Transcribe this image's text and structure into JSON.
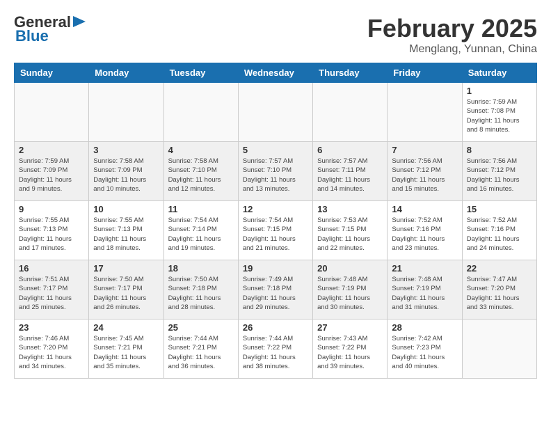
{
  "header": {
    "logo_general": "General",
    "logo_blue": "Blue",
    "month": "February 2025",
    "location": "Menglang, Yunnan, China"
  },
  "days_of_week": [
    "Sunday",
    "Monday",
    "Tuesday",
    "Wednesday",
    "Thursday",
    "Friday",
    "Saturday"
  ],
  "weeks": [
    [
      {
        "day": "",
        "info": ""
      },
      {
        "day": "",
        "info": ""
      },
      {
        "day": "",
        "info": ""
      },
      {
        "day": "",
        "info": ""
      },
      {
        "day": "",
        "info": ""
      },
      {
        "day": "",
        "info": ""
      },
      {
        "day": "1",
        "info": "Sunrise: 7:59 AM\nSunset: 7:08 PM\nDaylight: 11 hours and 8 minutes."
      }
    ],
    [
      {
        "day": "2",
        "info": "Sunrise: 7:59 AM\nSunset: 7:09 PM\nDaylight: 11 hours and 9 minutes."
      },
      {
        "day": "3",
        "info": "Sunrise: 7:58 AM\nSunset: 7:09 PM\nDaylight: 11 hours and 10 minutes."
      },
      {
        "day": "4",
        "info": "Sunrise: 7:58 AM\nSunset: 7:10 PM\nDaylight: 11 hours and 12 minutes."
      },
      {
        "day": "5",
        "info": "Sunrise: 7:57 AM\nSunset: 7:10 PM\nDaylight: 11 hours and 13 minutes."
      },
      {
        "day": "6",
        "info": "Sunrise: 7:57 AM\nSunset: 7:11 PM\nDaylight: 11 hours and 14 minutes."
      },
      {
        "day": "7",
        "info": "Sunrise: 7:56 AM\nSunset: 7:12 PM\nDaylight: 11 hours and 15 minutes."
      },
      {
        "day": "8",
        "info": "Sunrise: 7:56 AM\nSunset: 7:12 PM\nDaylight: 11 hours and 16 minutes."
      }
    ],
    [
      {
        "day": "9",
        "info": "Sunrise: 7:55 AM\nSunset: 7:13 PM\nDaylight: 11 hours and 17 minutes."
      },
      {
        "day": "10",
        "info": "Sunrise: 7:55 AM\nSunset: 7:13 PM\nDaylight: 11 hours and 18 minutes."
      },
      {
        "day": "11",
        "info": "Sunrise: 7:54 AM\nSunset: 7:14 PM\nDaylight: 11 hours and 19 minutes."
      },
      {
        "day": "12",
        "info": "Sunrise: 7:54 AM\nSunset: 7:15 PM\nDaylight: 11 hours and 21 minutes."
      },
      {
        "day": "13",
        "info": "Sunrise: 7:53 AM\nSunset: 7:15 PM\nDaylight: 11 hours and 22 minutes."
      },
      {
        "day": "14",
        "info": "Sunrise: 7:52 AM\nSunset: 7:16 PM\nDaylight: 11 hours and 23 minutes."
      },
      {
        "day": "15",
        "info": "Sunrise: 7:52 AM\nSunset: 7:16 PM\nDaylight: 11 hours and 24 minutes."
      }
    ],
    [
      {
        "day": "16",
        "info": "Sunrise: 7:51 AM\nSunset: 7:17 PM\nDaylight: 11 hours and 25 minutes."
      },
      {
        "day": "17",
        "info": "Sunrise: 7:50 AM\nSunset: 7:17 PM\nDaylight: 11 hours and 26 minutes."
      },
      {
        "day": "18",
        "info": "Sunrise: 7:50 AM\nSunset: 7:18 PM\nDaylight: 11 hours and 28 minutes."
      },
      {
        "day": "19",
        "info": "Sunrise: 7:49 AM\nSunset: 7:18 PM\nDaylight: 11 hours and 29 minutes."
      },
      {
        "day": "20",
        "info": "Sunrise: 7:48 AM\nSunset: 7:19 PM\nDaylight: 11 hours and 30 minutes."
      },
      {
        "day": "21",
        "info": "Sunrise: 7:48 AM\nSunset: 7:19 PM\nDaylight: 11 hours and 31 minutes."
      },
      {
        "day": "22",
        "info": "Sunrise: 7:47 AM\nSunset: 7:20 PM\nDaylight: 11 hours and 33 minutes."
      }
    ],
    [
      {
        "day": "23",
        "info": "Sunrise: 7:46 AM\nSunset: 7:20 PM\nDaylight: 11 hours and 34 minutes."
      },
      {
        "day": "24",
        "info": "Sunrise: 7:45 AM\nSunset: 7:21 PM\nDaylight: 11 hours and 35 minutes."
      },
      {
        "day": "25",
        "info": "Sunrise: 7:44 AM\nSunset: 7:21 PM\nDaylight: 11 hours and 36 minutes."
      },
      {
        "day": "26",
        "info": "Sunrise: 7:44 AM\nSunset: 7:22 PM\nDaylight: 11 hours and 38 minutes."
      },
      {
        "day": "27",
        "info": "Sunrise: 7:43 AM\nSunset: 7:22 PM\nDaylight: 11 hours and 39 minutes."
      },
      {
        "day": "28",
        "info": "Sunrise: 7:42 AM\nSunset: 7:23 PM\nDaylight: 11 hours and 40 minutes."
      },
      {
        "day": "",
        "info": ""
      }
    ]
  ]
}
